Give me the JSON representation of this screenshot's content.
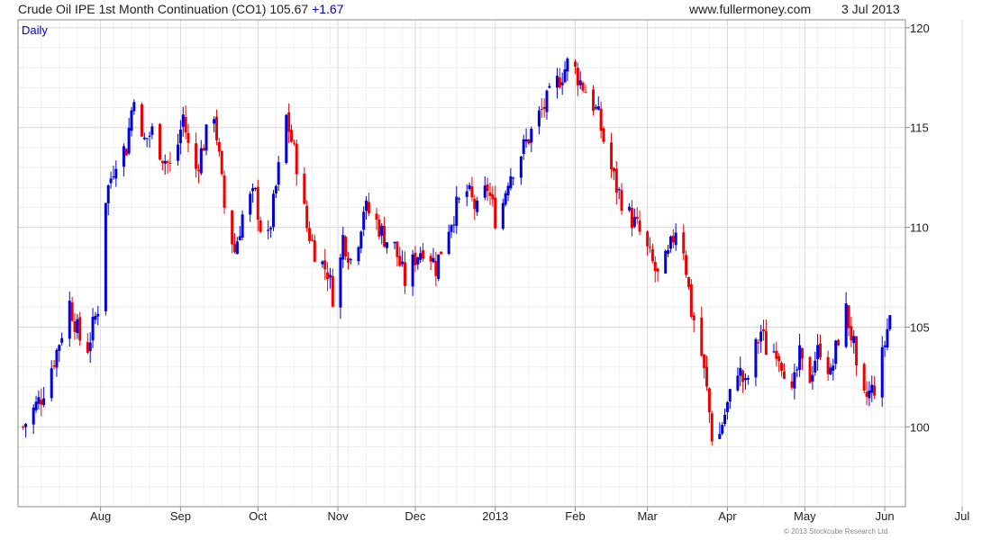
{
  "header": {
    "title": "Crude Oil IPE 1st Month Continuation (CO1) 105.67",
    "change": "+1.67",
    "website": "www.fullermoney.com",
    "date": "3 Jul 2013"
  },
  "footer": {
    "copyright": "© 2013 Stockcube Research Ltd"
  },
  "colors": {
    "up": "#0000dd",
    "down": "#ee0000",
    "grid": "#d9d9d9",
    "frame": "#888888",
    "label": "#0000cc"
  },
  "chart_data": {
    "type": "candlestick",
    "period_label": "Daily",
    "ylim": [
      96,
      120.4
    ],
    "y_ticks": [
      100,
      105,
      110,
      115,
      120
    ],
    "x_range_days": [
      -20,
      324
    ],
    "x_ticks": [
      {
        "label": "Aug",
        "day": 12
      },
      {
        "label": "Sep",
        "day": 43
      },
      {
        "label": "Oct",
        "day": 73
      },
      {
        "label": "Nov",
        "day": 104
      },
      {
        "label": "Dec",
        "day": 134
      },
      {
        "label": "2013",
        "day": 165
      },
      {
        "label": "Feb",
        "day": 196
      },
      {
        "label": "Mar",
        "day": 224
      },
      {
        "label": "Apr",
        "day": 255
      },
      {
        "label": "May",
        "day": 285
      },
      {
        "label": "Jun",
        "day": 316
      },
      {
        "label": "Jul",
        "day": 346
      }
    ],
    "close_path": [
      [
        -18,
        100.0
      ],
      [
        -11,
        101.5
      ],
      [
        -5,
        103.8
      ],
      [
        0,
        106.2
      ],
      [
        6,
        103.5
      ],
      [
        11,
        106.0
      ],
      [
        14,
        111.5
      ],
      [
        18,
        113.5
      ],
      [
        22,
        114.0
      ],
      [
        25,
        116.8
      ],
      [
        28,
        114.2
      ],
      [
        32,
        114.8
      ],
      [
        36,
        113.6
      ],
      [
        40,
        112.8
      ],
      [
        44,
        115.6
      ],
      [
        48,
        112.5
      ],
      [
        52,
        114.2
      ],
      [
        56,
        115.8
      ],
      [
        60,
        111.0
      ],
      [
        64,
        108.8
      ],
      [
        68,
        111.2
      ],
      [
        72,
        111.6
      ],
      [
        76,
        108.5
      ],
      [
        80,
        112.0
      ],
      [
        84,
        115.5
      ],
      [
        88,
        113.2
      ],
      [
        92,
        110.0
      ],
      [
        96,
        108.5
      ],
      [
        100,
        107.8
      ],
      [
        103,
        106.0
      ],
      [
        106,
        109.5
      ],
      [
        110,
        108.0
      ],
      [
        114,
        111.0
      ],
      [
        118,
        110.5
      ],
      [
        122,
        109.5
      ],
      [
        126,
        109.0
      ],
      [
        130,
        107.3
      ],
      [
        134,
        108.5
      ],
      [
        138,
        109.2
      ],
      [
        142,
        108.0
      ],
      [
        146,
        109.8
      ],
      [
        150,
        111.0
      ],
      [
        154,
        111.8
      ],
      [
        158,
        110.8
      ],
      [
        162,
        112.0
      ],
      [
        166,
        110.0
      ],
      [
        170,
        112.5
      ],
      [
        174,
        113.5
      ],
      [
        178,
        114.5
      ],
      [
        182,
        115.6
      ],
      [
        186,
        116.5
      ],
      [
        190,
        117.5
      ],
      [
        194,
        118.4
      ],
      [
        198,
        117.3
      ],
      [
        202,
        116.5
      ],
      [
        205,
        115.5
      ],
      [
        208,
        113.8
      ],
      [
        212,
        112.0
      ],
      [
        216,
        110.8
      ],
      [
        220,
        110.0
      ],
      [
        224,
        108.8
      ],
      [
        228,
        107.5
      ],
      [
        232,
        108.5
      ],
      [
        236,
        110.5
      ],
      [
        238,
        109.0
      ],
      [
        241,
        105.8
      ],
      [
        244,
        104.5
      ],
      [
        247,
        101.8
      ],
      [
        250,
        98.5
      ],
      [
        253,
        100.2
      ],
      [
        256,
        101.5
      ],
      [
        259,
        103.0
      ],
      [
        262,
        102.0
      ],
      [
        265,
        103.5
      ],
      [
        268,
        104.8
      ],
      [
        271,
        103.5
      ],
      [
        274,
        104.0
      ],
      [
        277,
        103.0
      ],
      [
        280,
        101.5
      ],
      [
        283,
        103.5
      ],
      [
        286,
        102.0
      ],
      [
        289,
        103.5
      ],
      [
        292,
        104.2
      ],
      [
        295,
        102.5
      ],
      [
        298,
        104.5
      ],
      [
        301,
        105.8
      ],
      [
        304,
        104.0
      ],
      [
        306,
        101.0
      ],
      [
        309,
        101.5
      ],
      [
        312,
        102.0
      ],
      [
        315,
        103.5
      ],
      [
        318,
        105.6
      ]
    ]
  }
}
